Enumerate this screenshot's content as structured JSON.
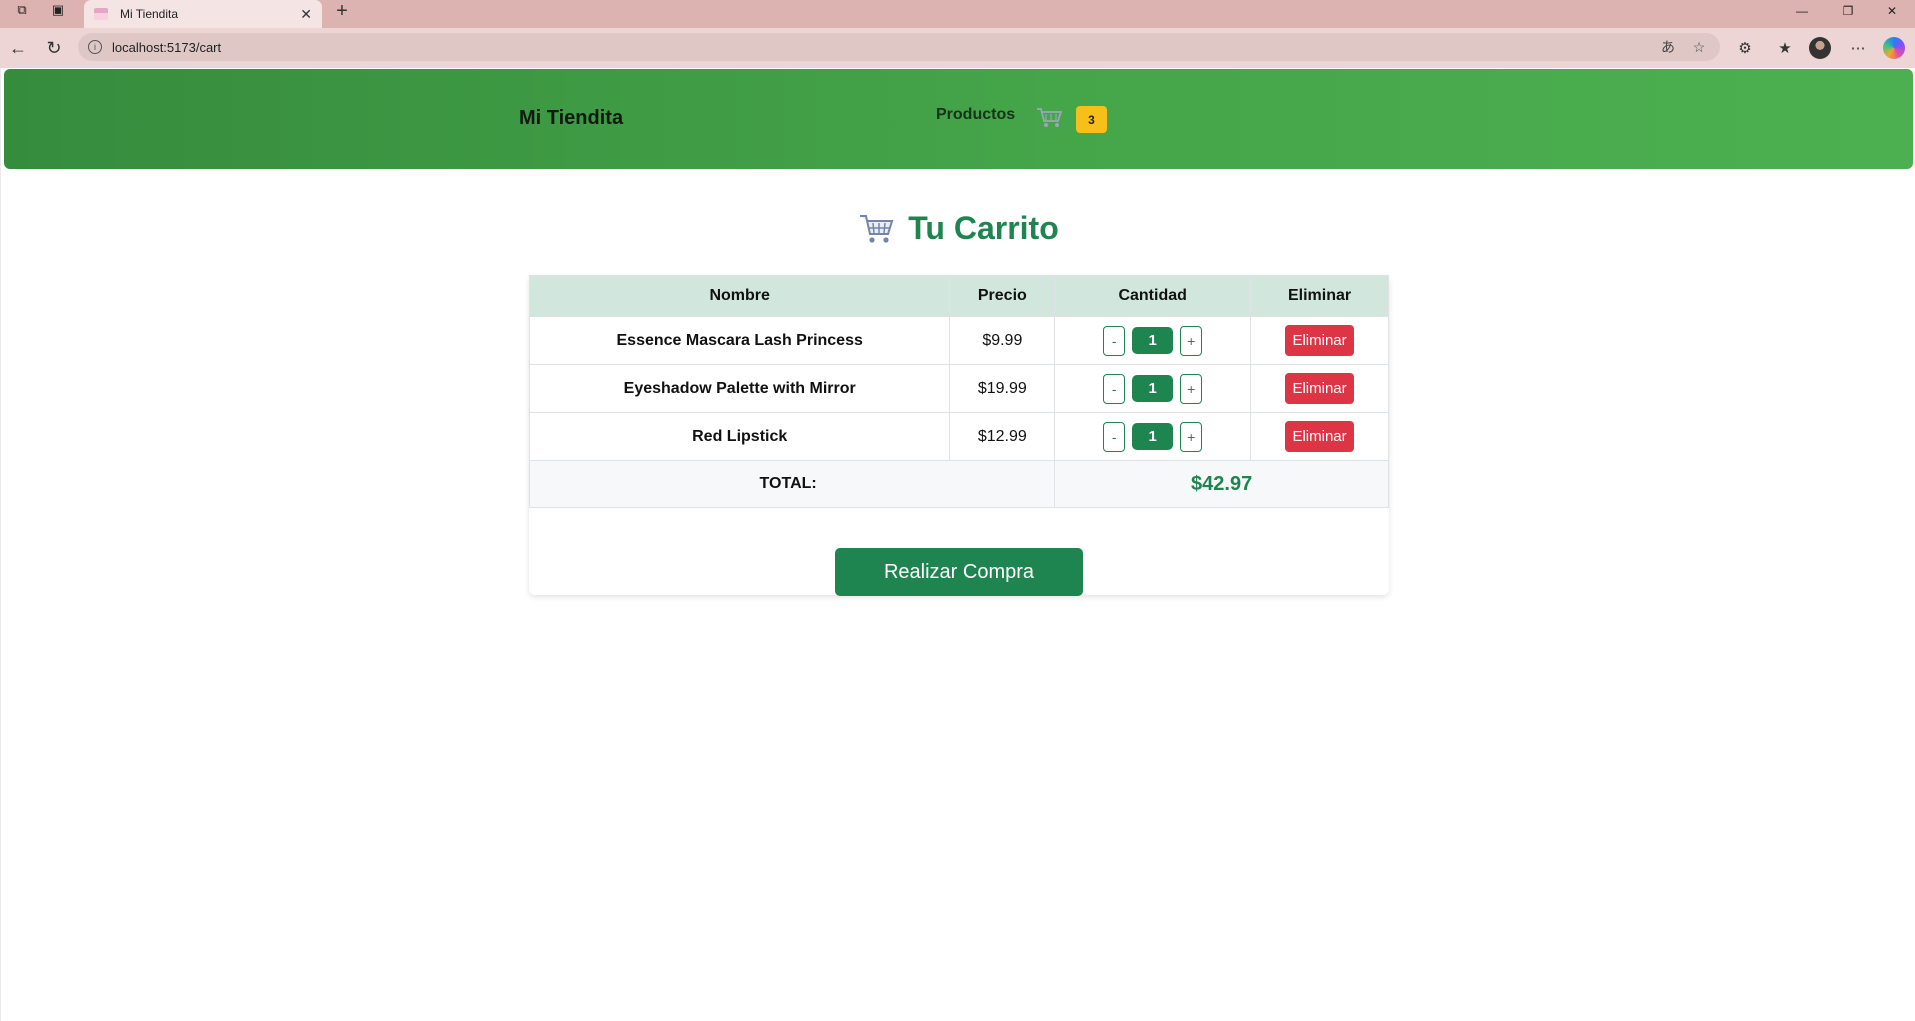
{
  "browser": {
    "tab_title": "Mi Tiendita",
    "url": "localhost:5173/cart"
  },
  "header": {
    "brand": "Mi Tiendita",
    "nav_products": "Productos",
    "cart_count": "3",
    "cart_badge_color": "#f6bf1a",
    "header_color": "#45a549"
  },
  "cart": {
    "title": "Tu Carrito",
    "columns": {
      "name": "Nombre",
      "price": "Precio",
      "quantity": "Cantidad",
      "remove": "Eliminar"
    },
    "items": [
      {
        "name": "Essence Mascara Lash Princess",
        "price": "$9.99",
        "qty": "1",
        "minus": "-",
        "plus": "+",
        "remove": "Eliminar"
      },
      {
        "name": "Eyeshadow Palette with Mirror",
        "price": "$19.99",
        "qty": "1",
        "minus": "-",
        "plus": "+",
        "remove": "Eliminar"
      },
      {
        "name": "Red Lipstick",
        "price": "$12.99",
        "qty": "1",
        "minus": "-",
        "plus": "+",
        "remove": "Eliminar"
      }
    ],
    "total_label": "TOTAL:",
    "total_value": "$42.97",
    "checkout_label": "Realizar Compra",
    "accent_color": "#1e8551",
    "danger_color": "#dc3545"
  }
}
